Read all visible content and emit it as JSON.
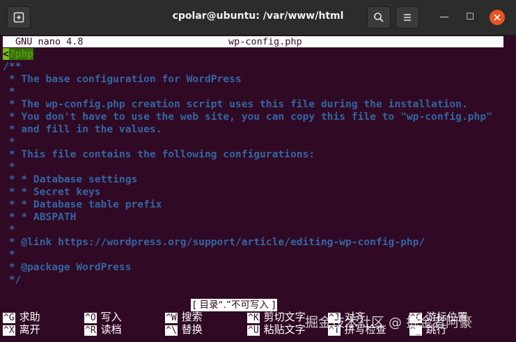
{
  "window": {
    "title": "cpolar@ubuntu: /var/www/html",
    "minimize_glyph": "—",
    "maximize_glyph": "☐"
  },
  "nano": {
    "version": "GNU nano 4.8",
    "filename": "wp-config.php"
  },
  "file_lines": [
    "<?php",
    "/**",
    " * The base configuration for WordPress",
    " *",
    " * The wp-config.php creation script uses this file during the installation.",
    " * You don't have to use the web site, you can copy this file to \"wp-config.php\"",
    " * and fill in the values.",
    " *",
    " * This file contains the following configurations:",
    " *",
    " * * Database settings",
    " * * Secret keys",
    " * * Database table prefix",
    " * * ABSPATH",
    " *",
    " * @link https://wordpress.org/support/article/editing-wp-config-php/",
    " *",
    " * @package WordPress",
    " */"
  ],
  "status_message": "[ 目录“.”不可写入 ]",
  "shortcuts": {
    "row1": [
      {
        "key": "^G",
        "label": "求助"
      },
      {
        "key": "^O",
        "label": "写入"
      },
      {
        "key": "^W",
        "label": "搜索"
      },
      {
        "key": "^K",
        "label": "剪切文字"
      },
      {
        "key": "^J",
        "label": "对齐"
      },
      {
        "key": "^C",
        "label": "游标位置"
      }
    ],
    "row2": [
      {
        "key": "^X",
        "label": "离开"
      },
      {
        "key": "^R",
        "label": "读档"
      },
      {
        "key": "^\\",
        "label": "替换"
      },
      {
        "key": "^U",
        "label": "粘贴文字"
      },
      {
        "key": "^T",
        "label": "拼写检查"
      },
      {
        "key": "^_",
        "label": "跳行"
      }
    ]
  },
  "watermark": "掘金技术社区 @ 掘金者阿豪",
  "colors": {
    "terminal_bg": "#300a24",
    "comment": "#3465a4",
    "php_tag": "#4e9a06",
    "titlebar_bg": "#2c2c2c",
    "close_button": "#e95420"
  }
}
